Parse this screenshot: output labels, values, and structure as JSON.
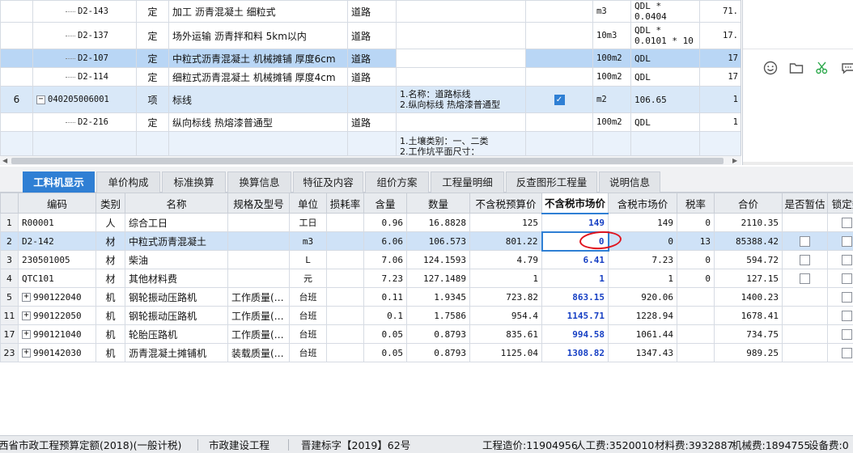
{
  "upper": {
    "rows": [
      {
        "idx": "",
        "code": "D2-143",
        "type": "定",
        "name": "加工 沥青混凝土 细粒式",
        "spec": "道路",
        "feature": "",
        "unit": "m3",
        "qty_expr": "QDL * 0.0404",
        "qty": "71."
      },
      {
        "idx": "",
        "code": "D2-137",
        "type": "定",
        "name": "场外运输 沥青拌和料 5km以内",
        "spec": "道路",
        "feature": "",
        "unit": "10m3",
        "qty_expr": "QDL * 0.0101 * 10",
        "qty": "17."
      },
      {
        "idx": "",
        "code": "D2-107",
        "type": "定",
        "name": "中粒式沥青混凝土 机械摊铺 厚度6cm",
        "spec": "道路",
        "feature": "",
        "unit": "100m2",
        "qty_expr": "QDL",
        "qty": "17"
      },
      {
        "idx": "",
        "code": "D2-114",
        "type": "定",
        "name": "细粒式沥青混凝土 机械摊铺 厚度4cm",
        "spec": "道路",
        "feature": "",
        "unit": "100m2",
        "qty_expr": "QDL",
        "qty": "17"
      },
      {
        "idx": "6",
        "code": "040205006001",
        "type": "项",
        "name": "标线",
        "spec": "",
        "feature": "1.名称：道路标线\n2.纵向标线 热熔漆普通型",
        "unit": "m2",
        "qty_expr": "106.65",
        "qty": "1"
      },
      {
        "idx": "",
        "code": "D2-216",
        "type": "定",
        "name": "纵向标线 热熔漆普通型",
        "spec": "道路",
        "feature": "",
        "unit": "100m2",
        "qty_expr": "QDL",
        "qty": "1"
      },
      {
        "idx": "",
        "code": "",
        "type": "",
        "name": "",
        "spec": "",
        "feature": "1.土壤类别：一、二类\n2.工作坑平面尺寸：",
        "unit": "",
        "qty_expr": "",
        "qty": ""
      }
    ]
  },
  "tabs": [
    "工料机显示",
    "单价构成",
    "标准换算",
    "换算信息",
    "特征及内容",
    "组价方案",
    "工程量明细",
    "反查图形工程量",
    "说明信息"
  ],
  "lower": {
    "headers": [
      "编码",
      "类别",
      "名称",
      "规格及型号",
      "单位",
      "损耗率",
      "含量",
      "数量",
      "不含税预算价",
      "不含税市场价",
      "含税市场价",
      "税率",
      "合价",
      "是否暂估",
      "锁定数"
    ],
    "rows": [
      {
        "idx": "1",
        "expand": false,
        "code": "R00001",
        "cat": "人",
        "name": "综合工日",
        "spec": "",
        "unit": "工日",
        "loss": "",
        "content": "0.96",
        "qty": "16.8828",
        "budget": "125",
        "market": "149",
        "taxmarket": "149",
        "rate": "0",
        "total": "2110.35",
        "check": false
      },
      {
        "idx": "2",
        "expand": false,
        "code": "D2-142",
        "cat": "材",
        "name": "中粒式沥青混凝土",
        "spec": "",
        "unit": "m3",
        "loss": "",
        "content": "6.06",
        "qty": "106.573",
        "budget": "801.22",
        "market": "0",
        "taxmarket": "0",
        "rate": "13",
        "total": "85388.42",
        "check": true
      },
      {
        "idx": "3",
        "expand": false,
        "code": "230501005",
        "cat": "材",
        "name": "柴油",
        "spec": "",
        "unit": "L",
        "loss": "",
        "content": "7.06",
        "qty": "124.1593",
        "budget": "4.79",
        "market": "6.41",
        "taxmarket": "7.23",
        "rate": "0",
        "total": "594.72",
        "check": true
      },
      {
        "idx": "4",
        "expand": false,
        "code": "QTC101",
        "cat": "材",
        "name": "其他材料费",
        "spec": "",
        "unit": "元",
        "loss": "",
        "content": "7.23",
        "qty": "127.1489",
        "budget": "1",
        "market": "1",
        "taxmarket": "1",
        "rate": "0",
        "total": "127.15",
        "check": true
      },
      {
        "idx": "5",
        "expand": true,
        "code": "990122040",
        "cat": "机",
        "name": "钢轮振动压路机",
        "spec": "工作质量(…",
        "unit": "台班",
        "loss": "",
        "content": "0.11",
        "qty": "1.9345",
        "budget": "723.82",
        "market": "863.15",
        "taxmarket": "920.06",
        "rate": "",
        "total": "1400.23",
        "check": false
      },
      {
        "idx": "11",
        "expand": true,
        "code": "990122050",
        "cat": "机",
        "name": "钢轮振动压路机",
        "spec": "工作质量(…",
        "unit": "台班",
        "loss": "",
        "content": "0.1",
        "qty": "1.7586",
        "budget": "954.4",
        "market": "1145.71",
        "taxmarket": "1228.94",
        "rate": "",
        "total": "1678.41",
        "check": false
      },
      {
        "idx": "17",
        "expand": true,
        "code": "990121040",
        "cat": "机",
        "name": "轮胎压路机",
        "spec": "工作质量(…",
        "unit": "台班",
        "loss": "",
        "content": "0.05",
        "qty": "0.8793",
        "budget": "835.61",
        "market": "994.58",
        "taxmarket": "1061.44",
        "rate": "",
        "total": "734.75",
        "check": false
      },
      {
        "idx": "23",
        "expand": true,
        "code": "990142030",
        "cat": "机",
        "name": "沥青混凝土摊铺机",
        "spec": "装载质量(…",
        "unit": "台班",
        "loss": "",
        "content": "0.05",
        "qty": "0.8793",
        "budget": "1125.04",
        "market": "1308.82",
        "taxmarket": "1347.43",
        "rate": "",
        "total": "989.25",
        "check": false
      }
    ]
  },
  "status": {
    "quota": "西省市政工程预算定额(2018)(一般计税)",
    "project_type": "市政建设工程",
    "standard": "晋建标字【2019】62号",
    "cost": "工程造价:11904956",
    "labor": "人工费:3520010",
    "material": "材料费:3932887",
    "machine": "机械费:1894755",
    "equipment": "设备费:0"
  },
  "icons": {
    "emoji": "smiley-icon",
    "folder": "folder-icon",
    "scissors": "scissors-icon",
    "chat": "chat-bubble-icon"
  },
  "colors": {
    "accent": "#2f7fd4",
    "highlight_value": "#1740c4",
    "annotation": "#e0141e"
  }
}
